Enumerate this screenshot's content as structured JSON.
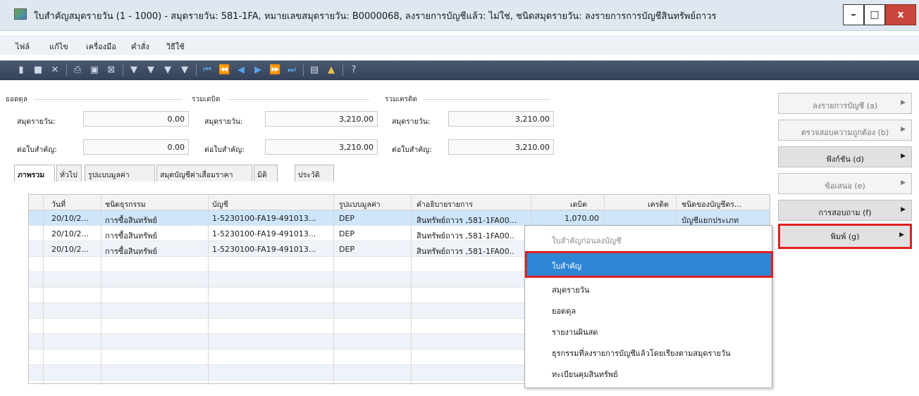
{
  "window": {
    "title": "ใบสำคัญสมุดรายวัน (1 - 1000) - สมุดรายวัน: 581-1FA, หมายเลขสมุดรายวัน: B0000068, ลงรายการบัญชีแล้ว: ไม่ใช่, ชนิดสมุดรายวัน: ลงรายการการบัญชีสินทรัพย์ถาวร",
    "controls": [
      "–",
      "□",
      "x"
    ]
  },
  "menu": [
    "ไฟล์",
    "แก้ไข",
    "เครื่องมือ",
    "คำสั่ง",
    "วิธีใช้"
  ],
  "toolbar_icons": [
    "new-icon",
    "save-icon",
    "delete-icon",
    "print-icon",
    "preview-icon",
    "export-icon",
    "filter-icon",
    "filter-select-icon",
    "filter-clear-icon",
    "filter-advanced-icon",
    "first-record-icon",
    "prev-page-icon",
    "prev-record-icon",
    "next-record-icon",
    "next-page-icon",
    "last-record-icon",
    "document-icon",
    "alert-icon",
    "help-icon"
  ],
  "summary": {
    "balance": {
      "label": "ยอดดุล",
      "journal_label": "สมุดรายวัน:",
      "journal_value": "0.00",
      "voucher_label": "ต่อใบสำคัญ:",
      "voucher_value": "0.00"
    },
    "debit": {
      "label": "รวมเดบิต",
      "journal_label": "สมุดรายวัน:",
      "journal_value": "3,210.00",
      "voucher_label": "ต่อใบสำคัญ:",
      "voucher_value": "3,210.00"
    },
    "credit": {
      "label": "รวมเครดิต",
      "journal_label": "สมุดรายวัน:",
      "journal_value": "3,210.00",
      "voucher_label": "ต่อใบสำคัญ:",
      "voucher_value": "3,210.00"
    }
  },
  "tabs": [
    "ภาพรวม",
    "ทั่วไป",
    "รูปแบบมูลค่า",
    "สมุดบัญชีค่าเสื่อมราคา",
    "มิติ",
    "ประวัติ"
  ],
  "grid": {
    "columns": [
      "วันที่",
      "ชนิดธุรกรรม",
      "บัญชี",
      "รูปแบบมูลค่า",
      "คำอธิบายรายการ",
      "เดบิต",
      "เครดิต",
      "ชนิดของบัญชีตร..."
    ],
    "rows": [
      [
        "20/10/2...",
        "การซื้อสินทรัพย์",
        "1-5230100-FA19-491013...",
        "DEP",
        "สินทรัพย์ถาวร ,581-1FA00...",
        "1,070.00",
        "",
        "บัญชีแยกประเภท"
      ],
      [
        "20/10/2...",
        "การซื้อสินทรัพย์",
        "1-5230100-FA19-491013...",
        "DEP",
        "สินทรัพย์ถาวร ,581-1FA00..",
        "",
        "",
        ""
      ],
      [
        "20/10/2...",
        "การซื้อสินทรัพย์",
        "1-5230100-FA19-491013...",
        "DEP",
        "สินทรัพย์ถาวร ,581-1FA00..",
        "",
        "",
        ""
      ]
    ]
  },
  "right_panel": [
    {
      "label": "ลงรายการบัญชี (a)",
      "enabled": false
    },
    {
      "label": "ตรวจสอบความถูกต้อง (b)",
      "enabled": false
    },
    {
      "label": "ฟังก์ชัน (d)",
      "enabled": true
    },
    {
      "label": "ข้อเสนอ (e)",
      "enabled": false
    },
    {
      "label": "การสอบถาม (f)",
      "enabled": true
    },
    {
      "label": "พิมพ์ (g)",
      "enabled": true
    }
  ],
  "print_menu": [
    {
      "label": "ใบสำคัญก่อนลงบัญชี",
      "state": "disabled"
    },
    {
      "label": "ใบสำคัญ",
      "state": "active"
    },
    {
      "label": "สมุดรายวัน",
      "state": "normal"
    },
    {
      "label": "ยอดดุล",
      "state": "normal"
    },
    {
      "label": "รายงานผินสด",
      "state": "normal"
    },
    {
      "label": "ธุรกรรมที่ลงรายการบัญชีแล้วโดยเรียงตามสมุดรายวัน",
      "state": "normal"
    },
    {
      "label": "ทะเบียนคุมสินทรัพย์",
      "state": "normal"
    }
  ]
}
